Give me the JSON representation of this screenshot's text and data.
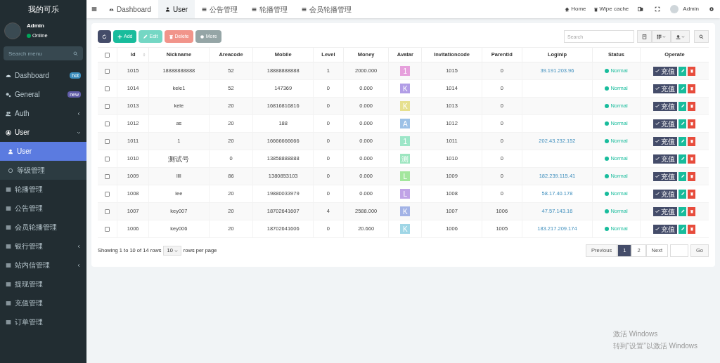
{
  "sidebar": {
    "title": "我的可乐",
    "user": {
      "name": "Admin",
      "status": "Online"
    },
    "search": {
      "placeholder": "Search menu"
    },
    "items": [
      {
        "kind": "dashboard",
        "label": "Dashboard",
        "badge": {
          "text": "hot",
          "color": "#3c8dbc"
        },
        "selected": false
      },
      {
        "kind": "gears",
        "label": "General",
        "badge": {
          "text": "new",
          "color": "#605ca8"
        },
        "selected": false
      },
      {
        "kind": "users",
        "label": "Auth",
        "expanded": false,
        "selected": false
      },
      {
        "kind": "profile",
        "label": "User",
        "expanded": true,
        "selected": false,
        "children": [
          {
            "kind": "user",
            "label": "User",
            "selected": true
          },
          {
            "kind": "circle",
            "label": "等级管理",
            "selected": false
          }
        ]
      },
      {
        "kind": "list",
        "label": "轮播管理",
        "selected": false
      },
      {
        "kind": "list",
        "label": "公告管理",
        "selected": false
      },
      {
        "kind": "list",
        "label": "会员轮播管理",
        "selected": false
      },
      {
        "kind": "list",
        "label": "银行管理",
        "expanded": false,
        "selected": false
      },
      {
        "kind": "list",
        "label": "站内信管理",
        "expanded": false,
        "selected": false
      },
      {
        "kind": "list",
        "label": "提现管理",
        "selected": false
      },
      {
        "kind": "list",
        "label": "充值管理",
        "selected": false
      },
      {
        "kind": "list",
        "label": "订单管理",
        "selected": false
      }
    ]
  },
  "topbar": {
    "tabs": [
      {
        "kind": "dashboard",
        "label": "Dashboard",
        "selected": false
      },
      {
        "kind": "user",
        "label": "User",
        "selected": true
      },
      {
        "kind": "list",
        "label": "公告管理",
        "selected": false
      },
      {
        "kind": "list",
        "label": "轮播管理",
        "selected": false
      },
      {
        "kind": "list",
        "label": "会员轮播管理",
        "selected": false
      }
    ],
    "links": [
      {
        "kind": "home",
        "label": "Home"
      },
      {
        "kind": "trash",
        "label": "Wipe cache"
      }
    ],
    "user": "Admin"
  },
  "toolbar": {
    "buttons": [
      {
        "kind": "refresh",
        "disabled": false
      },
      {
        "kind": "add",
        "label": "Add",
        "disabled": false
      },
      {
        "kind": "edit",
        "label": "Edit",
        "disabled": true
      },
      {
        "kind": "delete",
        "label": "Delete",
        "disabled": true
      },
      {
        "kind": "more",
        "label": "More",
        "disabled": false
      }
    ],
    "search": {
      "placeholder": "Search"
    }
  },
  "table": {
    "header_checked": false,
    "columns": [
      {
        "label": "Id",
        "sortable": true
      },
      {
        "label": "Nickname"
      },
      {
        "label": "Areacode"
      },
      {
        "label": "Mobile"
      },
      {
        "label": "Level"
      },
      {
        "label": "Money"
      },
      {
        "label": "Avatar"
      },
      {
        "label": "Invitationcode"
      },
      {
        "label": "Parentid"
      },
      {
        "label": "Loginip"
      },
      {
        "label": "Status"
      },
      {
        "label": "Operate"
      }
    ],
    "rows": [
      {
        "checked": false,
        "id": "1015",
        "nickname": "18888888888",
        "areacode": "52",
        "mobile": "18888888888",
        "level": "1",
        "money": "2000.000",
        "avatar": {
          "letter": "1",
          "color": "#e6a0dc"
        },
        "invitationcode": "1015",
        "parentid": "0",
        "loginip": "39.191.203.96",
        "status": "Normal",
        "recharge": "充值"
      },
      {
        "checked": false,
        "id": "1014",
        "nickname": "kele1",
        "areacode": "52",
        "mobile": "147369",
        "level": "0",
        "money": "0.000",
        "avatar": {
          "letter": "K",
          "color": "#b19de6"
        },
        "invitationcode": "1014",
        "parentid": "0",
        "status": "Normal",
        "recharge": "充值"
      },
      {
        "checked": false,
        "id": "1013",
        "nickname": "kele",
        "areacode": "20",
        "mobile": "16816816816",
        "level": "0",
        "money": "0.000",
        "avatar": {
          "letter": "K",
          "color": "#e6e08f"
        },
        "invitationcode": "1013",
        "parentid": "0",
        "status": "Normal",
        "recharge": "充值"
      },
      {
        "checked": false,
        "id": "1012",
        "nickname": "as",
        "areacode": "20",
        "mobile": "188",
        "level": "0",
        "money": "0.000",
        "avatar": {
          "letter": "A",
          "color": "#9cc1e6"
        },
        "invitationcode": "1012",
        "parentid": "0",
        "status": "Normal",
        "recharge": "充值"
      },
      {
        "checked": false,
        "id": "1011",
        "nickname": "1",
        "areacode": "20",
        "mobile": "16666666666",
        "level": "0",
        "money": "0.000",
        "avatar": {
          "letter": "1",
          "color": "#9de6c8"
        },
        "invitationcode": "1011",
        "parentid": "0",
        "loginip": "202.43.232.152",
        "status": "Normal",
        "recharge": "充值"
      },
      {
        "checked": false,
        "id": "1010",
        "nickname": "测试号",
        "areacode": "0",
        "mobile": "13858888888",
        "level": "0",
        "money": "0.000",
        "avatar": {
          "letter": "测",
          "color": "#9de6c0"
        },
        "invitationcode": "1010",
        "parentid": "0",
        "status": "Normal",
        "recharge": "充值"
      },
      {
        "checked": false,
        "id": "1009",
        "nickname": "llll",
        "areacode": "86",
        "mobile": "1380853103",
        "level": "0",
        "money": "0.000",
        "avatar": {
          "letter": "L",
          "color": "#a3e69d"
        },
        "invitationcode": "1009",
        "parentid": "0",
        "loginip": "182.239.115.41",
        "status": "Normal",
        "recharge": "充值"
      },
      {
        "checked": false,
        "id": "1008",
        "nickname": "lee",
        "areacode": "20",
        "mobile": "19880033979",
        "level": "0",
        "money": "0.000",
        "avatar": {
          "letter": "L",
          "color": "#c0a3e6"
        },
        "invitationcode": "1008",
        "parentid": "0",
        "loginip": "58.17.40.178",
        "status": "Normal",
        "recharge": "充值"
      },
      {
        "checked": false,
        "id": "1007",
        "nickname": "key007",
        "areacode": "20",
        "mobile": "18702641607",
        "level": "4",
        "money": "2588.000",
        "avatar": {
          "letter": "K",
          "color": "#a3b3e6"
        },
        "invitationcode": "1007",
        "parentid": "1006",
        "loginip": "47.57.143.16",
        "status": "Normal",
        "recharge": "充值"
      },
      {
        "checked": false,
        "id": "1006",
        "nickname": "key006",
        "areacode": "20",
        "mobile": "18702641606",
        "level": "0",
        "money": "20.660",
        "avatar": {
          "letter": "K",
          "color": "#9fd6e6"
        },
        "invitationcode": "1006",
        "parentid": "1005",
        "loginip": "183.217.209.174",
        "status": "Normal",
        "recharge": "充值"
      }
    ]
  },
  "pagination": {
    "summary": "Showing 1 to 10 of 14 rows",
    "page_size": "10",
    "page_size_suffix": "rows per page",
    "previous": "Previous",
    "pages": [
      {
        "label": "1",
        "selected": true
      },
      {
        "label": "2",
        "selected": false
      }
    ],
    "next": "Next",
    "go": "Go"
  },
  "os_notice": {
    "title": "激活 Windows",
    "text": "转到“设置”以激活 Windows"
  }
}
